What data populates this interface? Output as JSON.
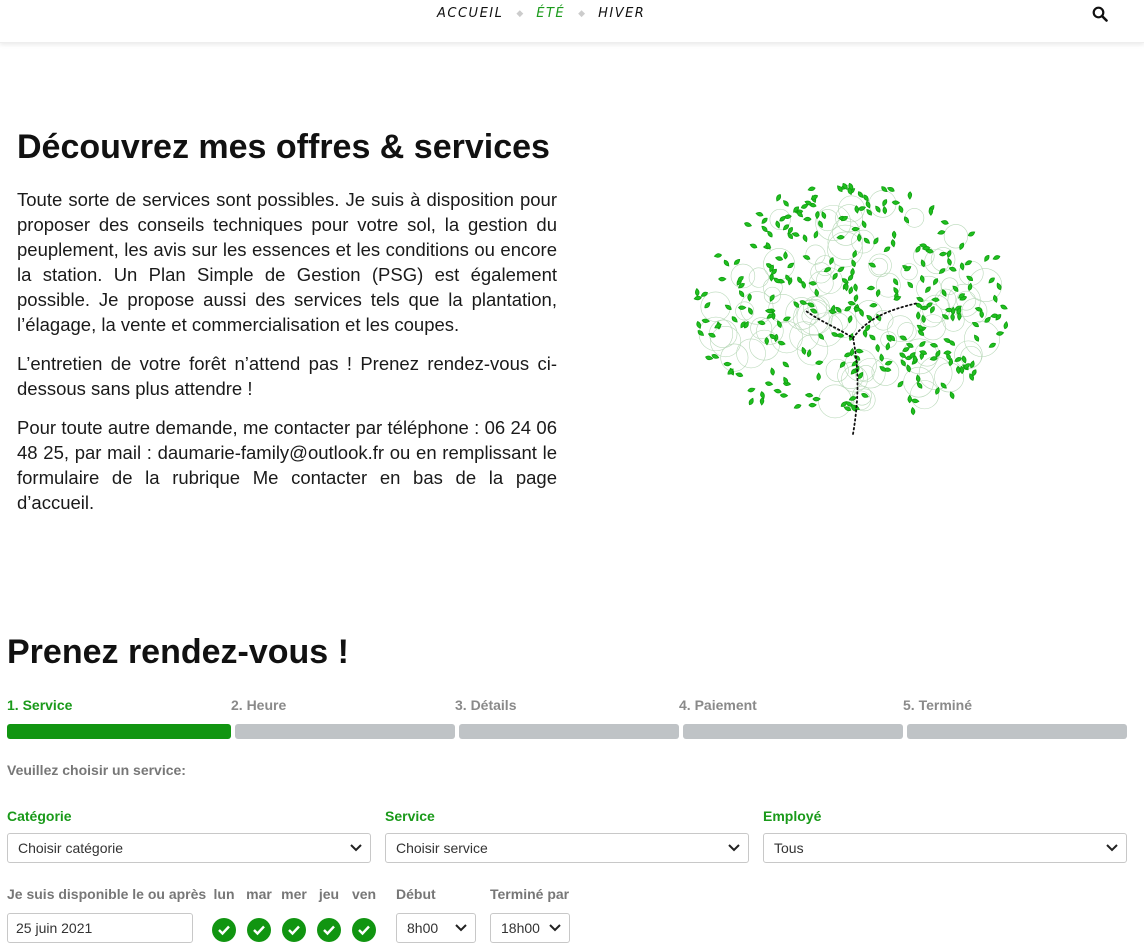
{
  "nav": {
    "items": [
      {
        "label": "ACCUEIL",
        "active": false
      },
      {
        "label": "ÉTÉ",
        "active": true
      },
      {
        "label": "HIVER",
        "active": false
      }
    ],
    "search_icon": "search-icon"
  },
  "intro": {
    "title": "Découvrez mes offres & services",
    "paragraphs": [
      "Toute sorte de services sont possibles. Je suis à disposition pour proposer des conseils techniques pour votre sol, la gestion du peuplement, les avis sur les essences et les conditions ou encore la station. Un Plan Simple de Gestion (PSG) est également possible. Je propose aussi des services tels que la plantation, l’élagage, la vente et commercialisation et les coupes.",
      "L’entretien de votre forêt n’attend pas ! Prenez rendez-vous ci-dessous sans plus attendre !",
      "Pour toute autre demande, me contacter par téléphone : 06 24 06 48 25, par mail : daumarie-family@outlook.fr ou  en remplissant le formulaire de la rubrique Me contacter en bas de la page d’accueil."
    ],
    "image_icon": "tree-illustration"
  },
  "booking": {
    "title": "Prenez rendez-vous !",
    "steps": [
      {
        "label": "1. Service",
        "active": true
      },
      {
        "label": "2. Heure",
        "active": false
      },
      {
        "label": "3. Détails",
        "active": false
      },
      {
        "label": "4. Paiement",
        "active": false
      },
      {
        "label": "5. Terminé",
        "active": false
      }
    ],
    "choose_label": "Veuillez choisir un service:",
    "category": {
      "label": "Catégorie",
      "value": "Choisir catégorie"
    },
    "service": {
      "label": "Service",
      "value": "Choisir service"
    },
    "employee": {
      "label": "Employé",
      "value": "Tous"
    },
    "availability": {
      "label": "Je suis disponible le ou après",
      "date": "25 juin 2021",
      "days": [
        "lun",
        "mar",
        "mer",
        "jeu",
        "ven"
      ],
      "start_label": "Début",
      "start_value": "8h00",
      "end_label": "Terminé par",
      "end_value": "18h00"
    },
    "colors": {
      "accent": "#119511",
      "inactive_bar": "#bfc3c6"
    }
  }
}
